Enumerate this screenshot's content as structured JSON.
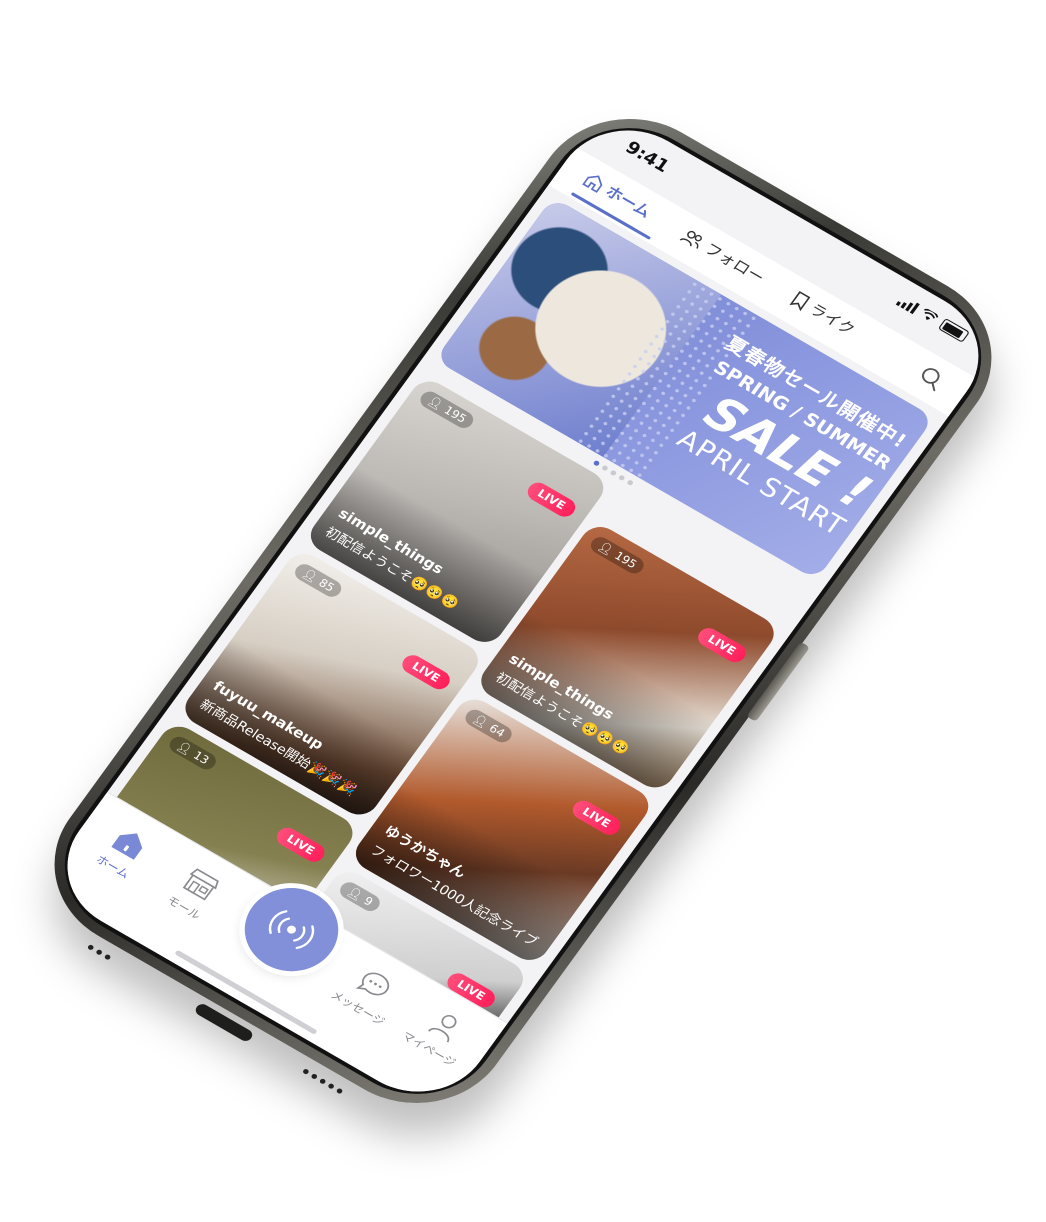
{
  "status": {
    "time": "9:41"
  },
  "tabs": [
    {
      "label": "ホーム",
      "icon": "home-icon",
      "active": true
    },
    {
      "label": "フォロー",
      "icon": "people-icon",
      "active": false
    },
    {
      "label": "ライク",
      "icon": "bookmark-icon",
      "active": false
    }
  ],
  "banner": {
    "line1": "夏春物セール開催中!",
    "line2": "SPRING / SUMMER",
    "line3": "SALE !",
    "line4": "APRIL START",
    "pages": 5,
    "current_page": 1
  },
  "streams": [
    {
      "viewers": "195",
      "live_label": "LIVE",
      "name": "simple_things",
      "title": "初配信ようこそ🥺🥺🥺"
    },
    {
      "viewers": "195",
      "live_label": "LIVE",
      "name": "simple_things",
      "title": "初配信ようこそ🥺🥺🥺"
    },
    {
      "viewers": "85",
      "live_label": "LIVE",
      "name": "fuyuu_makeup",
      "title": "新商品Release開始🎉🎉🎉"
    },
    {
      "viewers": "64",
      "live_label": "LIVE",
      "name": "ゆうかちゃん",
      "title": "フォロワー1000人記念ライブ"
    },
    {
      "viewers": "13",
      "live_label": "LIVE",
      "name": "",
      "title": ""
    },
    {
      "viewers": "9",
      "live_label": "LIVE",
      "name": "",
      "title": ""
    }
  ],
  "bottom_nav": [
    {
      "label": "ホーム",
      "icon": "home-icon",
      "active": true
    },
    {
      "label": "モール",
      "icon": "store-icon",
      "active": false
    },
    {
      "label": "",
      "icon": "broadcast-icon",
      "active": false
    },
    {
      "label": "メッセージ",
      "icon": "chat-icon",
      "active": false
    },
    {
      "label": "マイページ",
      "icon": "person-icon",
      "active": false
    }
  ],
  "colors": {
    "accent": "#5a6fc9",
    "live": "#ff2d5e",
    "banner": "#7f8dd6"
  }
}
